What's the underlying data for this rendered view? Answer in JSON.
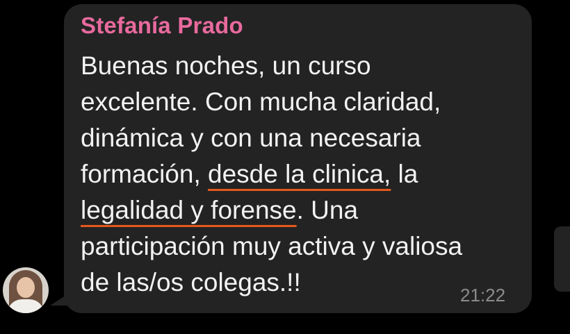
{
  "message": {
    "sender": "Stefanía Prado",
    "lines": [
      [
        "Buenas noches, un curso"
      ],
      [
        "excelente. Con mucha claridad,"
      ],
      [
        "dinámica y con una necesaria"
      ],
      [
        "formación, ",
        "desde la clinica,",
        " la"
      ],
      [
        "legalidad y forense",
        ". Una"
      ],
      [
        "participación muy activa y valiosa"
      ],
      [
        "de las/os colegas.!!"
      ]
    ],
    "time": "21:22"
  },
  "colors": {
    "background": "#000000",
    "bubble": "#232323",
    "sender_name": "#e86a9e",
    "message_text": "#f2f2f2",
    "underline": "#e4581c",
    "timestamp": "#8c8c8c"
  },
  "icons": {
    "avatar": "sender-avatar-photo"
  }
}
